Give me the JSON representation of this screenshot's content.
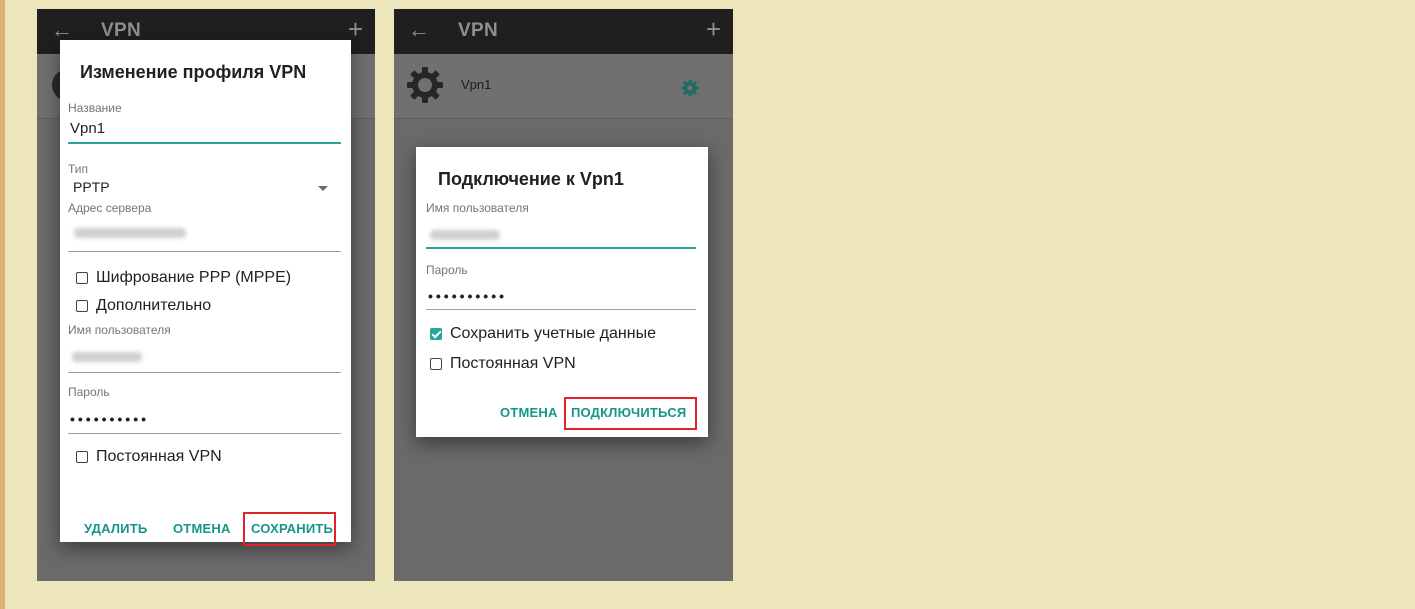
{
  "screen_edit": {
    "appbar": {
      "back_icon": "arrow-left-icon",
      "title": "VPN",
      "add_icon": "plus-icon"
    },
    "dialog": {
      "title": "Изменение профиля VPN",
      "name_label": "Название",
      "name_value": "Vpn1",
      "type_label": "Тип",
      "type_value": "PPTP",
      "server_label": "Адрес сервера",
      "encryption_label": "Шифрование PPP (MPPE)",
      "advanced_label": "Дополнительно",
      "username_label": "Имя пользователя",
      "password_label": "Пароль",
      "password_value": "••••••••••",
      "always_on_label": "Постоянная VPN",
      "delete_button": "УДАЛИТЬ",
      "cancel_button": "ОТМЕНА",
      "save_button": "СОХРАНИТЬ"
    }
  },
  "screen_connect": {
    "appbar": {
      "back_icon": "arrow-left-icon",
      "title": "VPN",
      "add_icon": "plus-icon"
    },
    "list_item": {
      "icon": "vpn-settings-icon",
      "name": "Vpn1",
      "settings_icon": "gear-icon"
    },
    "dialog": {
      "title": "Подключение к Vpn1",
      "username_label": "Имя пользователя",
      "password_label": "Пароль",
      "password_value": "••••••••••",
      "save_credentials_label": "Сохранить учетные данные",
      "save_credentials_checked": true,
      "always_on_label": "Постоянная VPN",
      "cancel_button": "ОТМЕНА",
      "connect_button": "ПОДКЛЮЧИТЬСЯ"
    }
  },
  "colors": {
    "accent": "#159688",
    "highlight": "#e0242b",
    "page_background": "#ede6bd"
  }
}
